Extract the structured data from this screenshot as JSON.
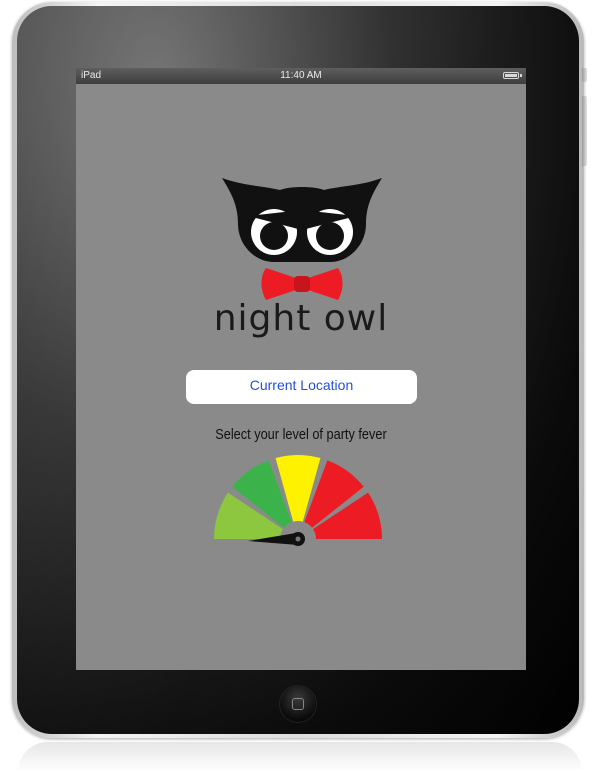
{
  "status_bar": {
    "carrier": "iPad",
    "time": "11:40 AM"
  },
  "app": {
    "brand_name": "night owl",
    "location_button_label": "Current Location",
    "fever_prompt": "Select your level of party fever"
  },
  "gauge": {
    "segment_colors": [
      "#8dc63f",
      "#3bb34a",
      "#fff200",
      "#ed1c24",
      "#ed1c24"
    ],
    "selected_level": 1
  },
  "colors": {
    "screen_background": "#8a8a8a",
    "bowtie": "#ed1c24",
    "link_blue": "#2451d6"
  },
  "icons": {
    "logo": "owl-logo-icon",
    "battery": "battery-icon",
    "home": "home-button-icon"
  }
}
